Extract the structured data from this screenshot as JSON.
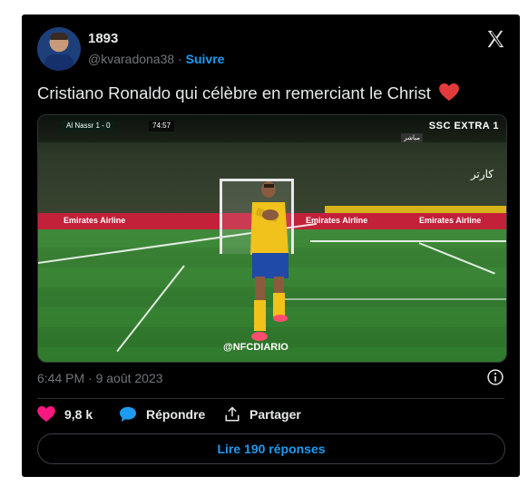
{
  "author": {
    "name": "1893",
    "handle": "@kvaradona38",
    "separator": "·",
    "follow_label": "Suivre"
  },
  "tweet": {
    "text": "Cristiano Ronaldo qui célèbre en remerciant le Christ"
  },
  "media": {
    "score_text": "Al Nassr 1 - 0",
    "match_time": "74:57",
    "broadcaster": "SSC  EXTRA 1",
    "live_label": "مباشر",
    "ad_text": "Emirates Airline",
    "arabic_tag": "كارتر",
    "watermark": "@NFCDIARIO"
  },
  "meta": {
    "timestamp": "6:44 PM · 9 août 2023"
  },
  "actions": {
    "likes": "9,8 k",
    "reply_label": "Répondre",
    "share_label": "Partager"
  },
  "replies_button": "Lire 190 réponses",
  "colors": {
    "background": "#000000",
    "accent": "#1d9bf0",
    "heart": "#f91880",
    "emoji_heart": "#e23b3b"
  },
  "icons": [
    "x-logo-icon",
    "heart-emoji-icon",
    "info-icon",
    "like-heart-icon",
    "reply-bubble-icon",
    "share-icon"
  ]
}
